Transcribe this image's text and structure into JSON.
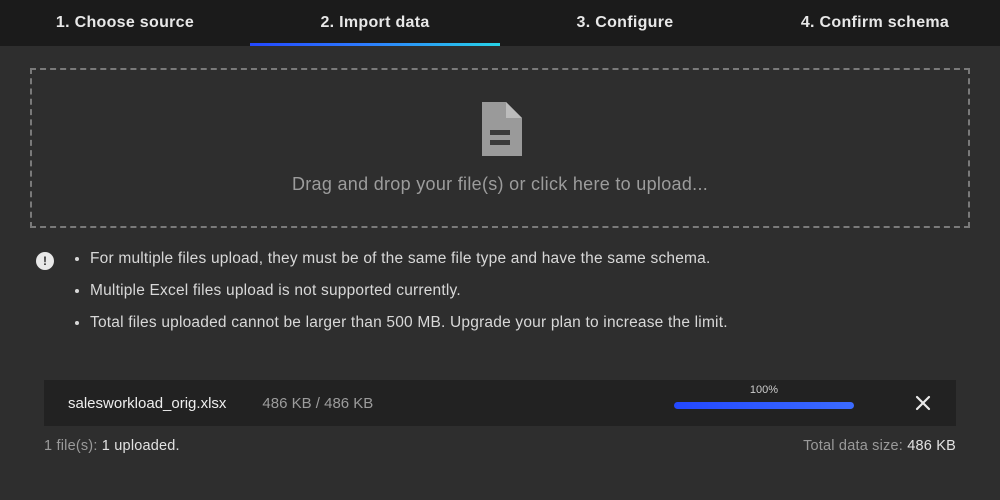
{
  "steps": [
    {
      "label": "1. Choose source",
      "active": false
    },
    {
      "label": "2. Import data",
      "active": true
    },
    {
      "label": "3. Configure",
      "active": false
    },
    {
      "label": "4. Confirm schema",
      "active": false
    }
  ],
  "dropzone": {
    "text": "Drag and drop your file(s) or click here to upload..."
  },
  "info_icon": "!",
  "info_notes": [
    "For multiple files upload, they must be of the same file type and have the same schema.",
    "Multiple Excel files upload is not supported currently.",
    "Total files uploaded cannot be larger than 500 MB. Upgrade your plan to increase the limit."
  ],
  "upload": {
    "filename": "salesworkload_orig.xlsx",
    "size_label": "486 KB / 486 KB",
    "progress_pct": "100%",
    "progress_width": "100%"
  },
  "summary": {
    "count_prefix": "1 file(s): ",
    "count_value": "1 uploaded.",
    "total_prefix": "Total data size: ",
    "total_value": "486 KB"
  }
}
